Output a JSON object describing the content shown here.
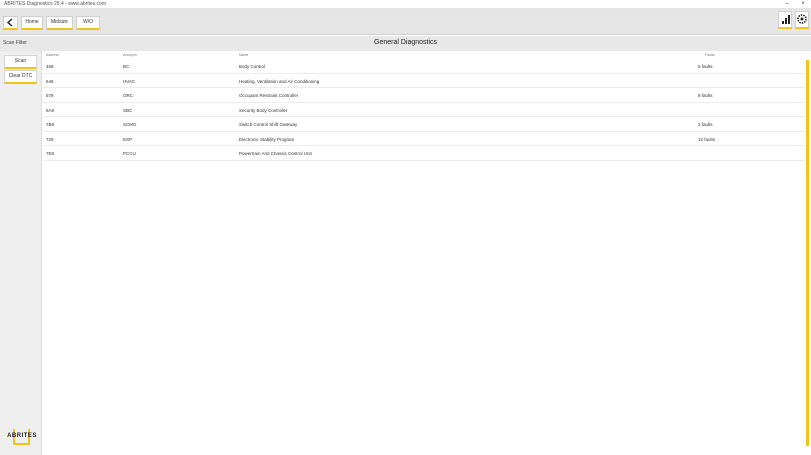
{
  "window": {
    "title": "ABRITES Diagnostics 25.4 - www.abrites.com",
    "minimize_glyph": "–",
    "close_glyph": "×"
  },
  "toolbar": {
    "back_icon": "chevron-left-icon",
    "breadcrumbs": [
      "Home",
      "Midsize",
      "W/O"
    ],
    "signal_icon": "signal-bars-icon",
    "settings_icon": "gear-icon"
  },
  "subheader": {
    "left_label": "Scan Filter",
    "page_title": "General Diagnostics"
  },
  "sidebar": {
    "buttons": [
      "Scan",
      "Clear DTC"
    ],
    "logo_text": "ABRITES"
  },
  "table": {
    "columns": [
      "Address",
      "Acronym",
      "Name",
      "Faults"
    ],
    "rows": [
      {
        "address": "468",
        "acronym": "BC",
        "name": "Body Control",
        "faults": "5 faults"
      },
      {
        "address": "648",
        "acronym": "HVAC",
        "name": "Heating, Ventilation and Air Conditioning",
        "faults": ""
      },
      {
        "address": "578",
        "acronym": "ORC",
        "name": "Occupant Restraint Controller",
        "faults": "8 faults"
      },
      {
        "address": "6A8",
        "acronym": "SBC",
        "name": "Security Body Controller",
        "faults": ""
      },
      {
        "address": "7B8",
        "acronym": "SCMG",
        "name": "Switch Control Shift Gateway",
        "faults": "2 faults"
      },
      {
        "address": "728",
        "acronym": "ESP",
        "name": "Electronic Stability Program",
        "faults": "12 faults"
      },
      {
        "address": "7E8",
        "acronym": "PCCU",
        "name": "Powertrain And Chassis Control Unit",
        "faults": ""
      }
    ]
  },
  "colors": {
    "accent": "#f0c419",
    "toolbar_bg": "#e6e6e6",
    "sidebar_bg": "#efefef"
  }
}
